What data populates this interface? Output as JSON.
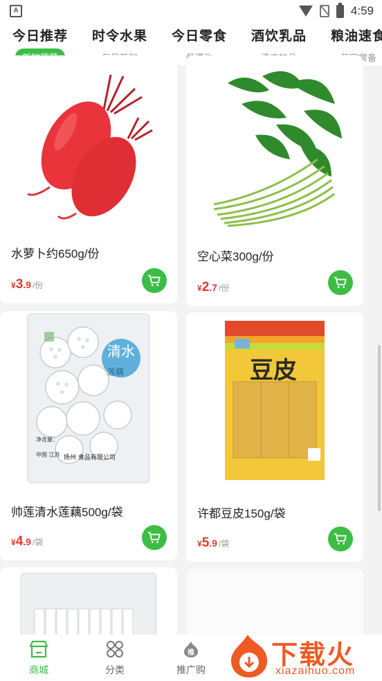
{
  "status_bar": {
    "time": "4:59",
    "app_badge": "A"
  },
  "categories": [
    {
      "title": "今日推荐",
      "subtitle": "新鲜蔬菜",
      "active": true
    },
    {
      "title": "时令水果",
      "subtitle": "每日新鲜",
      "active": false
    },
    {
      "title": "今日零食",
      "subtitle": "最懂你",
      "active": false
    },
    {
      "title": "酒饮乳品",
      "subtitle": "清爽饮品",
      "active": false
    },
    {
      "title": "粮油速食",
      "subtitle": "每家常备",
      "active": false
    }
  ],
  "products": [
    {
      "name": "水萝卜约650g/份",
      "currency": "¥",
      "price_int": "3",
      "price_dec": ".9",
      "unit": "/份",
      "image": "red-radish"
    },
    {
      "name": "空心菜300g/份",
      "currency": "¥",
      "price_int": "2",
      "price_dec": ".7",
      "unit": "/份",
      "image": "water-spinach"
    },
    {
      "name": "帅莲清水莲藕500g/袋",
      "currency": "¥",
      "price_int": "4",
      "price_dec": ".9",
      "unit": "/袋",
      "image": "lotus-root-pack"
    },
    {
      "name": "许都豆皮150g/袋",
      "currency": "¥",
      "price_int": "5",
      "price_dec": ".9",
      "unit": "/袋",
      "image": "tofu-skin-pack"
    }
  ],
  "package_text": {
    "lotus_brand": "清水",
    "lotus_product": "莲藕",
    "lotus_weight": "净含量：",
    "lotus_origin": "中国 江苏",
    "lotus_company": "扬州 食品有限公司",
    "tofu_title": "豆皮"
  },
  "bottom_nav": [
    {
      "label": "商城",
      "icon": "shop-icon",
      "active": true
    },
    {
      "label": "分类",
      "icon": "category-icon",
      "active": false
    },
    {
      "label": "推广购",
      "icon": "promote-icon",
      "badge": "推",
      "active": false
    }
  ],
  "watermark": {
    "text": "下载火",
    "url": "xiazaihuo.com"
  },
  "colors": {
    "accent": "#3cbd45",
    "price": "#e33a2d",
    "watermark": "#ee5a24"
  }
}
